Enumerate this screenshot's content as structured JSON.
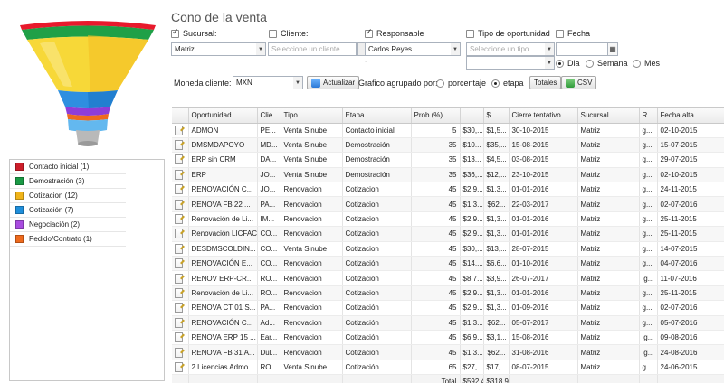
{
  "title": "Cono de la venta",
  "funnel": {
    "colors": [
      "#e8192c",
      "#1fa047",
      "#f7d12a",
      "#f4b21a",
      "#1f8fdb",
      "#8e3dd8",
      "#ef6a1d",
      "#3aa5e6"
    ]
  },
  "legend": [
    {
      "label": "Contacto inicial (1)",
      "color": "#cc1e2a"
    },
    {
      "label": "Demostración (3)",
      "color": "#1a9a45"
    },
    {
      "label": "Cotizacion (12)",
      "color": "#f0b419"
    },
    {
      "label": "Cotización (7)",
      "color": "#1f8fdb"
    },
    {
      "label": "Negociación (2)",
      "color": "#a94ce0"
    },
    {
      "label": "Pedido/Contrato (1)",
      "color": "#ee6a1d"
    }
  ],
  "filters": {
    "sucursal": {
      "label": "Sucursal:",
      "value": "Matriz"
    },
    "cliente": {
      "label": "Cliente:",
      "placeholder": "Seleccione un cliente",
      "btn": "..."
    },
    "responsable": {
      "label": "Responsable",
      "value": "Carlos Reyes",
      "sub": "-"
    },
    "tipo": {
      "label": "Tipo de oportunidad",
      "placeholder": "Seleccione un tipo"
    },
    "fecha": {
      "label": "Fecha"
    },
    "periodo": {
      "dia": "Dia",
      "semana": "Semana",
      "mes": "Mes"
    }
  },
  "toolbar": {
    "moneda_label": "Moneda cliente:",
    "moneda_value": "MXN",
    "actualizar": "Actualizar",
    "agrupado_label": "Grafico agrupado por:",
    "porcentaje": "porcentaje",
    "etapa": "etapa",
    "totales": "Totales",
    "csv": "CSV"
  },
  "table": {
    "columns": [
      "",
      "Oportunidad",
      "Clie...",
      "Tipo",
      "Etapa",
      "Prob.(%)",
      "...",
      "$ ...",
      "Cierre tentativo",
      "Sucursal",
      "R...",
      "Fecha alta"
    ],
    "rows": [
      [
        "ADMON",
        "PE...",
        "Venta Sinube",
        "Contacto inicial",
        "5",
        "$30,...",
        "$1,5...",
        "30-10-2015",
        "Matriz",
        "g...",
        "02-10-2015"
      ],
      [
        "DMSMDAPOYO",
        "MD...",
        "Venta Sinube",
        "Demostración",
        "35",
        "$10...",
        "$35,...",
        "15-08-2015",
        "Matriz",
        "g...",
        "15-07-2015"
      ],
      [
        "ERP sin CRM",
        "DA...",
        "Venta Sinube",
        "Demostración",
        "35",
        "$13...",
        "$4,5...",
        "03-08-2015",
        "Matriz",
        "g...",
        "29-07-2015"
      ],
      [
        "ERP",
        "JO...",
        "Venta Sinube",
        "Demostración",
        "35",
        "$36,...",
        "$12,...",
        "23-10-2015",
        "Matriz",
        "g...",
        "02-10-2015"
      ],
      [
        "RENOVACIÓN C...",
        "JO...",
        "Renovacion",
        "Cotizacion",
        "45",
        "$2,9...",
        "$1,3...",
        "01-01-2016",
        "Matriz",
        "g...",
        "24-11-2015"
      ],
      [
        "RENOVA FB 22 ...",
        "PA...",
        "Renovacion",
        "Cotizacion",
        "45",
        "$1,3...",
        "$62...",
        "22-03-2017",
        "Matriz",
        "g...",
        "02-07-2016"
      ],
      [
        "Renovación de Li...",
        "IM...",
        "Renovacion",
        "Cotizacion",
        "45",
        "$2,9...",
        "$1,3...",
        "01-01-2016",
        "Matriz",
        "g...",
        "25-11-2015"
      ],
      [
        "Renovación LICFAC",
        "CO...",
        "Renovacion",
        "Cotizacion",
        "45",
        "$2,9...",
        "$1,3...",
        "01-01-2016",
        "Matriz",
        "g...",
        "25-11-2015"
      ],
      [
        "DESDMSCOLDIN...",
        "CO...",
        "Venta Sinube",
        "Cotizacion",
        "45",
        "$30,...",
        "$13,...",
        "28-07-2015",
        "Matriz",
        "g...",
        "14-07-2015"
      ],
      [
        "RENOVACIÓN E...",
        "CO...",
        "Renovacion",
        "Cotización",
        "45",
        "$14,...",
        "$6,6...",
        "01-10-2016",
        "Matriz",
        "g...",
        "04-07-2016"
      ],
      [
        "RENOV ERP-CR...",
        "RO...",
        "Renovacion",
        "Cotización",
        "45",
        "$8,7...",
        "$3,9...",
        "26-07-2017",
        "Matriz",
        "ig...",
        "11-07-2016"
      ],
      [
        "Renovación de Li...",
        "RO...",
        "Renovacion",
        "Cotizacion",
        "45",
        "$2,9...",
        "$1,3...",
        "01-01-2016",
        "Matriz",
        "g...",
        "25-11-2015"
      ],
      [
        "RENOVA CT 01 S...",
        "PA...",
        "Renovacion",
        "Cotización",
        "45",
        "$2,9...",
        "$1,3...",
        "01-09-2016",
        "Matriz",
        "g...",
        "02-07-2016"
      ],
      [
        "RENOVACIÓN C...",
        "Ad...",
        "Renovacion",
        "Cotización",
        "45",
        "$1,3...",
        "$62...",
        "05-07-2017",
        "Matriz",
        "g...",
        "05-07-2016"
      ],
      [
        "RENOVA ERP 15 ...",
        "Ear...",
        "Renovacion",
        "Cotización",
        "45",
        "$6,9...",
        "$3,1...",
        "15-08-2016",
        "Matriz",
        "ig...",
        "09-08-2016"
      ],
      [
        "RENOVA FB 31 A...",
        "Dul...",
        "Renovacion",
        "Cotización",
        "45",
        "$1,3...",
        "$62...",
        "31-08-2016",
        "Matriz",
        "ig...",
        "24-08-2016"
      ],
      [
        "2 Licencias Admo...",
        "RO...",
        "Venta Sinube",
        "Cotización",
        "65",
        "$27,...",
        "$17,...",
        "08-07-2015",
        "Matriz",
        "g...",
        "24-06-2015"
      ]
    ],
    "footer": {
      "label": "Total",
      "sum1": "$592,4...",
      "sum2": "$318,9..."
    }
  }
}
